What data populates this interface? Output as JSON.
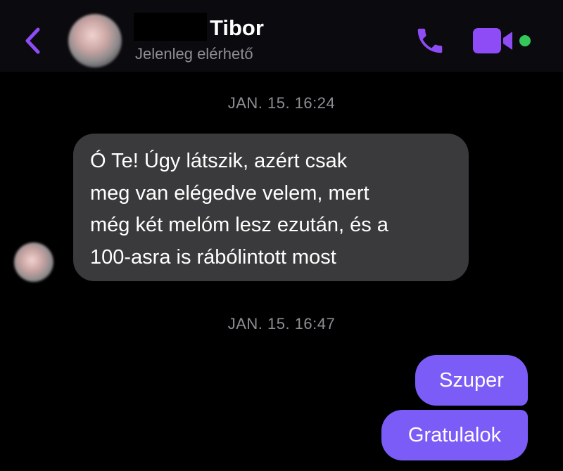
{
  "header": {
    "contact_name": "Tibor",
    "status": "Jelenleg elérhető",
    "online": true
  },
  "icons": {
    "back": "chevron-left-icon",
    "phone": "phone-icon",
    "video": "video-camera-icon"
  },
  "colors": {
    "accent": "#7c5cf7",
    "icon": "#8d4cf5",
    "incoming_bubble": "#3a3a3c",
    "online": "#34c759",
    "timestamp": "#8e8e93"
  },
  "messages": [
    {
      "timestamp": "JAN. 15. 16:24",
      "direction": "incoming",
      "lines": [
        "Ó Te! Úgy látszik, azért csak",
        "meg van elégedve velem, mert",
        "még két melóm lesz ezután, és a",
        "100-asra is rábólintott most"
      ]
    },
    {
      "timestamp": "JAN. 15. 16:47",
      "direction": "outgoing",
      "texts": [
        "Szuper",
        "Gratulalok"
      ]
    }
  ]
}
